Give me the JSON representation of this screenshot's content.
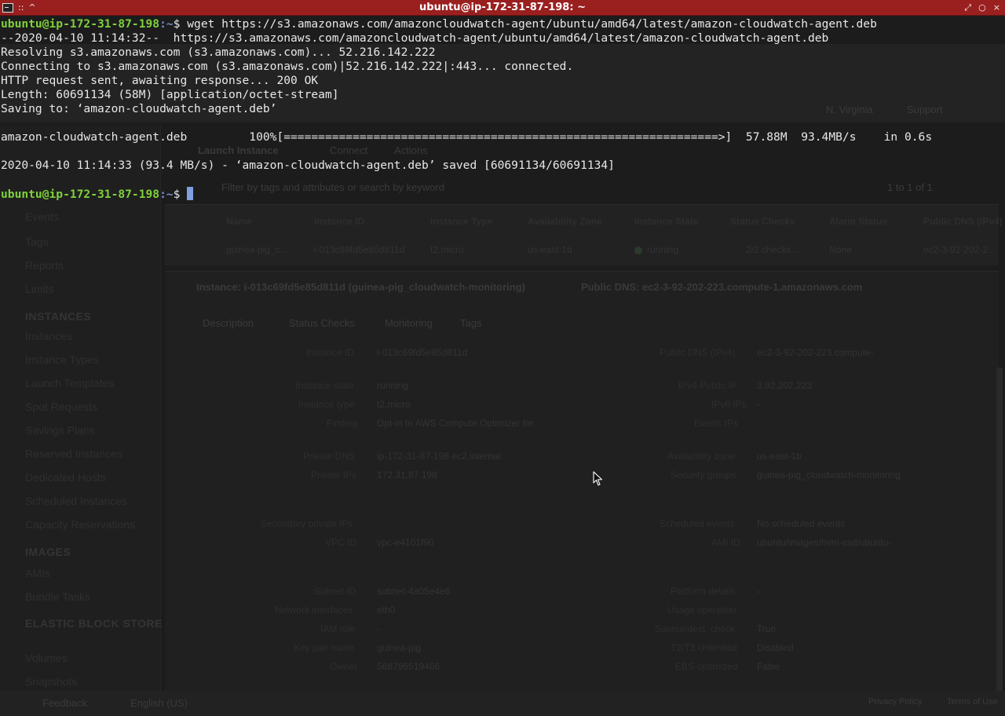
{
  "window": {
    "title": "ubuntu@ip-172-31-87-198: ~",
    "left_glyphs": [
      "::",
      "^"
    ],
    "right_glyphs": [
      "⤢",
      "○",
      "×"
    ]
  },
  "colors": {
    "titlebar": "#9a1f1f",
    "background": "#1c1c1c",
    "prompt_user": "#7fd13b",
    "prompt_path": "#6f8dd6",
    "text": "#e8e8e8",
    "cursor": "#7f9fe0"
  },
  "terminal": {
    "prompt_user": "ubuntu@ip-172-31-87-198",
    "prompt_path": ":~",
    "prompt_symbol": "$ ",
    "command": "wget https://s3.amazonaws.com/amazoncloudwatch-agent/ubuntu/amd64/latest/amazon-cloudwatch-agent.deb",
    "lines": [
      "--2020-04-10 11:14:32--  https://s3.amazonaws.com/amazoncloudwatch-agent/ubuntu/amd64/latest/amazon-cloudwatch-agent.deb",
      "Resolving s3.amazonaws.com (s3.amazonaws.com)... 52.216.142.222",
      "Connecting to s3.amazonaws.com (s3.amazonaws.com)|52.216.142.222|:443... connected.",
      "HTTP request sent, awaiting response... 200 OK",
      "Length: 60691134 (58M) [application/octet-stream]",
      "Saving to: ‘amazon-cloudwatch-agent.deb’",
      "",
      "amazon-cloudwatch-agent.deb         100%[===============================================================>]  57.88M  93.4MB/s    in 0.6s",
      "",
      "2020-04-10 11:14:33 (93.4 MB/s) - ‘amazon-cloudwatch-agent.deb’ saved [60691134/60691134]",
      ""
    ],
    "download_progress": 1.0
  },
  "ghost": {
    "sidebar_headings": [
      "INSTANCES",
      "IMAGES",
      "ELASTIC BLOCK STORE"
    ],
    "sidebar_items_top": [
      "Events",
      "Tags",
      "Reports",
      "Limits"
    ],
    "sidebar_items_instances": [
      "Instances",
      "Instance Types",
      "Launch Templates",
      "Spot Requests",
      "Savings Plans",
      "Reserved Instances",
      "Dedicated Hosts",
      "Scheduled Instances",
      "Capacity Reservations"
    ],
    "sidebar_items_images": [
      "AMIs",
      "Bundle Tasks"
    ],
    "sidebar_items_ebs": [
      "Volumes",
      "Snapshots"
    ],
    "nav": [
      "Launch Instance",
      "Connect",
      "Actions"
    ],
    "region": "N. Virginia",
    "support": "Support",
    "filter_placeholder": "Filter by tags and attributes or search by keyword",
    "pager": "1 to 1 of 1",
    "columns": [
      "Name",
      "Instance ID",
      "Instance Type",
      "Availability Zone",
      "Instance State",
      "Status Checks",
      "Alarm Status",
      "Public DNS (IPv4)"
    ],
    "row": [
      "guinea-pig_c...",
      "i-013c69fd5e85d811d",
      "t2.micro",
      "us-east-1b",
      "running",
      "2/2 checks ...",
      "None",
      "ec2-3-92-202-2..."
    ],
    "instance_header": "Instance: i-013c69fd5e85d811d (guinea-pig_cloudwatch-monitoring)",
    "public_dns_header": "Public DNS: ec2-3-92-202-223.compute-1.amazonaws.com",
    "tabs": [
      "Description",
      "Status Checks",
      "Monitoring",
      "Tags"
    ],
    "left_labels": [
      "Instance ID",
      "Instance state",
      "Instance type",
      "Finding",
      "Private DNS",
      "Private IPs",
      "Secondary private IPs",
      "VPC ID",
      "Subnet ID",
      "Network interfaces",
      "IAM role",
      "Key pair name",
      "Owner"
    ],
    "left_values": [
      "i-013c69fd5e85d811d",
      "running",
      "t2.micro",
      "Opt-in to AWS Compute Optimizer for",
      "ip-172-31-87-198.ec2.internal",
      "172.31.87.198",
      "",
      "vpc-e4101f90",
      "subnet-4a05e4e6",
      "eth0",
      "-",
      "guinea-pig",
      "568795519466"
    ],
    "right_labels": [
      "Public DNS (IPv4)",
      "IPv4 Public IP",
      "IPv6 IPs",
      "Elastic IPs",
      "Availability zone",
      "Security groups",
      "Scheduled events",
      "AMI ID",
      "Platform details",
      "Usage operation",
      "Source/dest. check",
      "T2/T3 Unlimited",
      "EBS-optimized"
    ],
    "right_values": [
      "ec2-3-92-202-223.compute-",
      "3.92.202.223",
      "-",
      "",
      "us-east-1b",
      "guinea-pig_cloudwatch-monitoring",
      "No scheduled events",
      "ubuntu/images/hvm-ssd/ubuntu-",
      "-",
      "",
      "True",
      "Disabled",
      "False"
    ],
    "footer_left": [
      "Feedback",
      "English (US)"
    ],
    "footer_right": [
      "Privacy Policy",
      "Terms of Use"
    ]
  }
}
